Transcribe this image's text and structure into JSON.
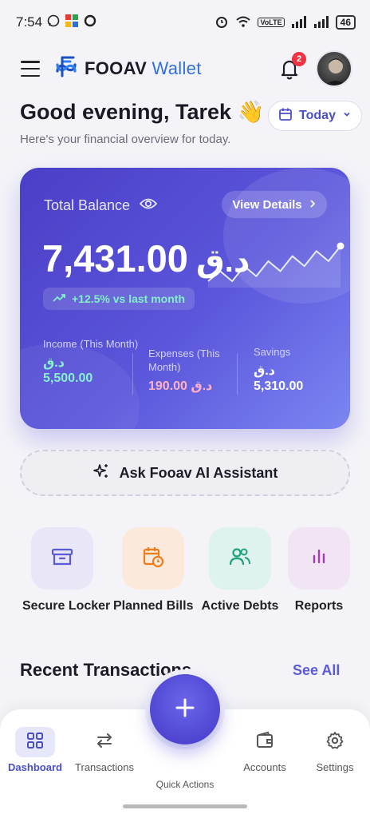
{
  "status_bar": {
    "time": "7:54",
    "battery": "46",
    "network": "VoLTE"
  },
  "header": {
    "brand_main": "FOOAV",
    "brand_accent": "Wallet",
    "notification_count": "2",
    "icons": [
      "menu-icon",
      "logo-icon",
      "bell-icon",
      "avatar"
    ]
  },
  "greeting": {
    "title": "Good evening, Tarek 👋",
    "subtitle": "Here's your financial overview for today."
  },
  "date_filter": {
    "label": "Today"
  },
  "balance_card": {
    "label": "Total Balance",
    "view_details": "View Details",
    "amount": "7,431.00",
    "currency": "د.ق",
    "change": "+12.5% vs last month",
    "trend_points": [
      3,
      5,
      3,
      6,
      4,
      7,
      5,
      8,
      6,
      9,
      7,
      10
    ],
    "stats": {
      "income_label": "Income (This Month)",
      "income_value": "د.ق\n5,500.00",
      "expenses_label": "Expenses (This Month)",
      "expenses_value": "190.00 د.ق",
      "savings_label": "Savings",
      "savings_value": "د.ق\n5,310.00"
    }
  },
  "ai_button": {
    "label": "Ask Fooav AI Assistant"
  },
  "quick_actions": [
    {
      "label": "Secure Locker",
      "icon": "archive-icon",
      "bg": "#e8e6f7",
      "color": "#5b5bd6"
    },
    {
      "label": "Planned Bills",
      "icon": "calendar-clock-icon",
      "bg": "#fbeadb",
      "color": "#ef7d1a"
    },
    {
      "label": "Active Debts",
      "icon": "users-icon",
      "bg": "#dff3ee",
      "color": "#1fa27a"
    },
    {
      "label": "Reports",
      "icon": "bar-chart-icon",
      "bg": "#f1e4f3",
      "color": "#a43bb5"
    }
  ],
  "recent": {
    "title": "Recent Transactions",
    "see_all": "See All"
  },
  "bottom_nav": {
    "items": [
      {
        "label": "Dashboard",
        "icon": "grid-icon",
        "active": true
      },
      {
        "label": "Transactions",
        "icon": "swap-arrows-icon",
        "active": false
      },
      {
        "label": "Accounts",
        "icon": "wallet-icon",
        "active": false
      },
      {
        "label": "Settings",
        "icon": "gear-icon",
        "active": false
      }
    ],
    "fab_label": "Quick Actions"
  },
  "colors": {
    "accent": "#5b5bd6",
    "card_start": "#4a3fc6",
    "card_end": "#7b86f2"
  }
}
